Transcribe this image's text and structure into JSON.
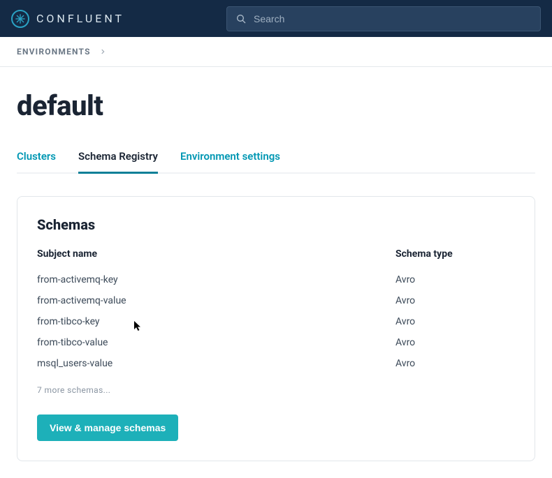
{
  "header": {
    "brand": "CONFLUENT",
    "search_placeholder": "Search"
  },
  "breadcrumb": {
    "label": "ENVIRONMENTS"
  },
  "page": {
    "title": "default"
  },
  "tabs": [
    {
      "label": "Clusters",
      "active": false
    },
    {
      "label": "Schema Registry",
      "active": true
    },
    {
      "label": "Environment settings",
      "active": false
    }
  ],
  "schemas_card": {
    "title": "Schemas",
    "columns": {
      "name": "Subject name",
      "type": "Schema type"
    },
    "rows": [
      {
        "name": "from-activemq-key",
        "type": "Avro"
      },
      {
        "name": "from-activemq-value",
        "type": "Avro"
      },
      {
        "name": "from-tibco-key",
        "type": "Avro"
      },
      {
        "name": "from-tibco-value",
        "type": "Avro"
      },
      {
        "name": "msql_users-value",
        "type": "Avro"
      }
    ],
    "more_text": "7 more schemas...",
    "cta_label": "View & manage schemas"
  }
}
